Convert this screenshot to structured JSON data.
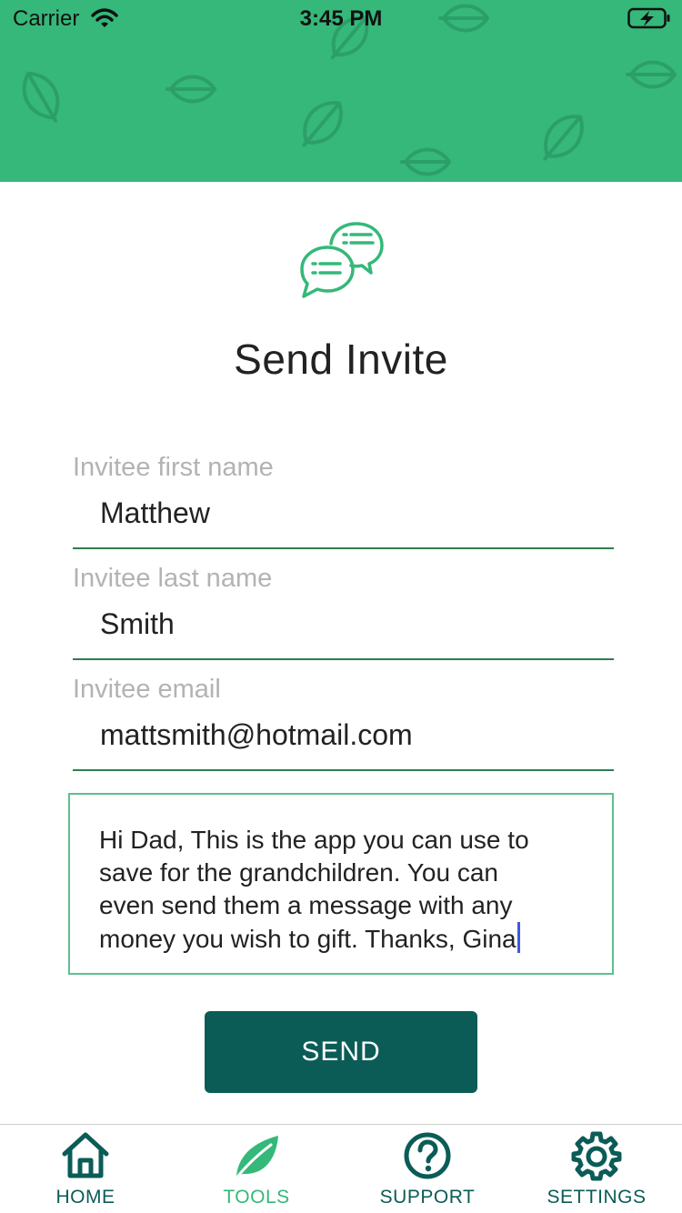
{
  "status_bar": {
    "carrier": "Carrier",
    "time": "3:45 PM"
  },
  "colors": {
    "header_green": "#35b87a",
    "button_teal": "#0b5c57",
    "field_underline": "#2e7d4f",
    "active_tab": "#35b87a"
  },
  "page": {
    "title": "Send Invite",
    "header_icon": "chat-bubbles-icon"
  },
  "form": {
    "first_name": {
      "label": "Invitee first name",
      "value": "Matthew"
    },
    "last_name": {
      "label": "Invitee last name",
      "value": "Smith"
    },
    "email": {
      "label": "Invitee email",
      "value": "mattsmith@hotmail.com"
    },
    "message": {
      "lines": [
        "Hi Dad, This is the app you can use to",
        "save for the grandchildren. You can",
        "even send them a message with any",
        "money you wish to gift. Thanks, Gina"
      ]
    },
    "send_label": "SEND"
  },
  "tab_bar": {
    "active": "tools",
    "tabs": [
      {
        "id": "home",
        "label": "HOME",
        "icon": "home-icon"
      },
      {
        "id": "tools",
        "label": "TOOLS",
        "icon": "leaf-icon"
      },
      {
        "id": "support",
        "label": "SUPPORT",
        "icon": "question-icon"
      },
      {
        "id": "settings",
        "label": "SETTINGS",
        "icon": "gear-icon"
      }
    ]
  }
}
